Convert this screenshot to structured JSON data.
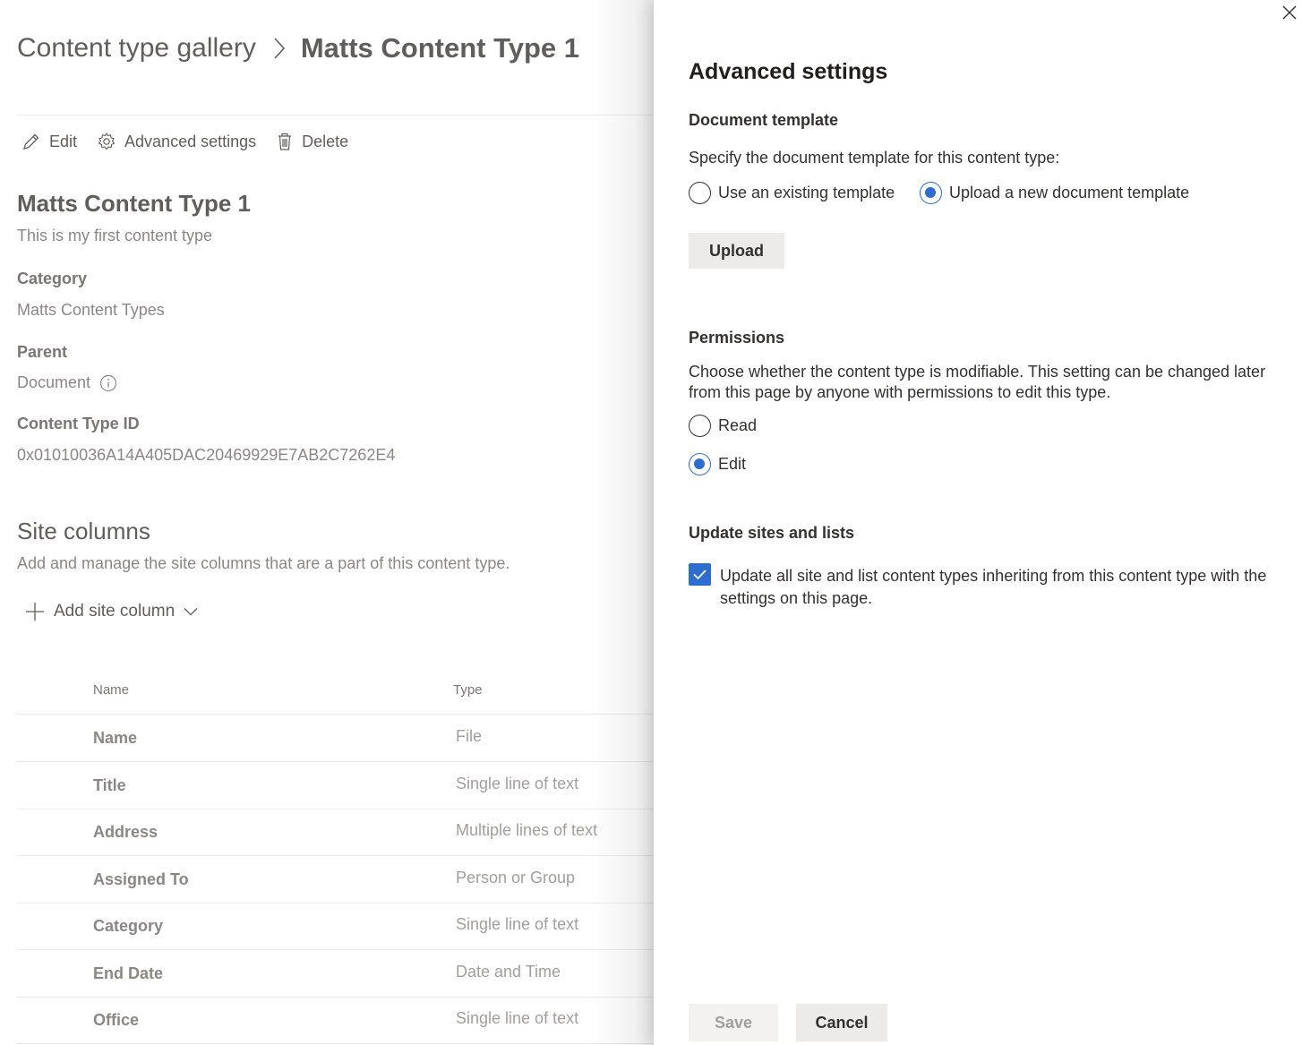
{
  "breadcrumb": {
    "root": "Content type gallery",
    "current": "Matts Content Type 1"
  },
  "commands": {
    "edit": "Edit",
    "advanced": "Advanced settings",
    "delete": "Delete"
  },
  "content_type": {
    "title": "Matts Content Type 1",
    "description": "This is my first content type",
    "category_label": "Category",
    "category_value": "Matts Content Types",
    "parent_label": "Parent",
    "parent_value": "Document",
    "id_label": "Content Type ID",
    "id_value": "0x01010036A14A405DAC20469929E7AB2C7262E4"
  },
  "site_columns": {
    "title": "Site columns",
    "description": "Add and manage the site columns that are a part of this content type.",
    "add_label": "Add site column",
    "headers": {
      "name": "Name",
      "type": "Type"
    },
    "rows": [
      {
        "name": "Name",
        "type": "File"
      },
      {
        "name": "Title",
        "type": "Single line of text"
      },
      {
        "name": "Address",
        "type": "Multiple lines of text"
      },
      {
        "name": "Assigned To",
        "type": "Person or Group"
      },
      {
        "name": "Category",
        "type": "Single line of text"
      },
      {
        "name": "End Date",
        "type": "Date and Time"
      },
      {
        "name": "Office",
        "type": "Single line of text"
      }
    ]
  },
  "panel": {
    "title": "Advanced settings",
    "doc_template": {
      "heading": "Document template",
      "prompt": "Specify the document template for this content type:",
      "option_existing": "Use an existing template",
      "option_upload": "Upload a new document template",
      "selected": "upload",
      "upload_button": "Upload"
    },
    "permissions": {
      "heading": "Permissions",
      "prompt": "Choose whether the content type is modifiable. This setting can be changed later from this page by anyone with permissions to edit this type.",
      "option_read": "Read",
      "option_edit": "Edit",
      "selected": "edit"
    },
    "update": {
      "heading": "Update sites and lists",
      "checkbox_label": "Update all site and list content types inheriting from this content type with the settings on this page.",
      "checked": true
    },
    "save_label": "Save",
    "cancel_label": "Cancel"
  },
  "colors": {
    "accent": "#2b6ed2"
  }
}
